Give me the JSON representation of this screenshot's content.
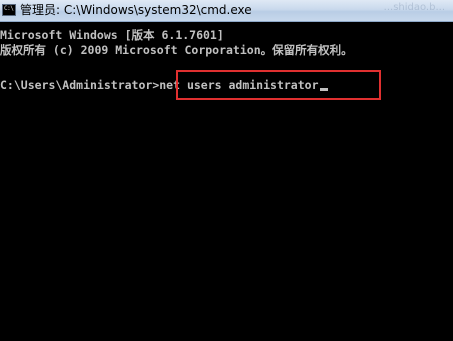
{
  "window": {
    "title": "管理员: C:\\Windows\\system32\\cmd.exe",
    "icon": "cmd-icon",
    "icon_text": "C:\\"
  },
  "console": {
    "lines": [
      "Microsoft Windows [版本 6.1.7601]",
      "版权所有 (c) 2009 Microsoft Corporation。保留所有权利。"
    ],
    "prompt": "C:\\Users\\Administrator>",
    "command": "net users administrator"
  },
  "watermark": "...shidao.b...",
  "colors": {
    "background": "#000000",
    "text": "#c0c0c0",
    "highlight_border": "#e03030",
    "titlebar": "#c9d9ec"
  }
}
